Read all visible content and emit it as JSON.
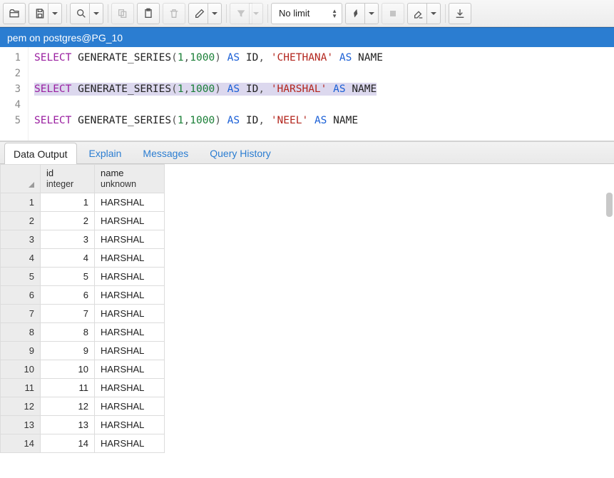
{
  "toolbar": {
    "limit_label": "No limit"
  },
  "titlebar": {
    "text": "pem on postgres@PG_10"
  },
  "editor": {
    "lines": [
      {
        "num": "1",
        "tokens": [
          {
            "t": "SELECT",
            "c": "kw"
          },
          {
            "t": " "
          },
          {
            "t": "GENERATE_SERIES",
            "c": ""
          },
          {
            "t": "(",
            "c": "punc"
          },
          {
            "t": "1",
            "c": "num"
          },
          {
            "t": ",",
            "c": "punc"
          },
          {
            "t": "1000",
            "c": "num"
          },
          {
            "t": ")",
            "c": "punc"
          },
          {
            "t": " "
          },
          {
            "t": "AS",
            "c": "kw2"
          },
          {
            "t": " ID"
          },
          {
            "t": ",",
            "c": "punc"
          },
          {
            "t": " "
          },
          {
            "t": "'CHETHANA'",
            "c": "str"
          },
          {
            "t": " "
          },
          {
            "t": "AS",
            "c": "kw2"
          },
          {
            "t": " NAME"
          }
        ],
        "hl": false
      },
      {
        "num": "2",
        "tokens": [],
        "hl": false
      },
      {
        "num": "3",
        "tokens": [
          {
            "t": "SELECT",
            "c": "kw"
          },
          {
            "t": " "
          },
          {
            "t": "GENERATE_SERIES",
            "c": ""
          },
          {
            "t": "(",
            "c": "punc"
          },
          {
            "t": "1",
            "c": "num"
          },
          {
            "t": ",",
            "c": "punc"
          },
          {
            "t": "1000",
            "c": "num"
          },
          {
            "t": ")",
            "c": "punc"
          },
          {
            "t": " "
          },
          {
            "t": "AS",
            "c": "kw2"
          },
          {
            "t": " ID"
          },
          {
            "t": ",",
            "c": "punc"
          },
          {
            "t": " "
          },
          {
            "t": "'HARSHAL'",
            "c": "str"
          },
          {
            "t": " "
          },
          {
            "t": "AS",
            "c": "kw2"
          },
          {
            "t": " NAME"
          }
        ],
        "hl": true
      },
      {
        "num": "4",
        "tokens": [],
        "hl": false
      },
      {
        "num": "5",
        "tokens": [
          {
            "t": "SELECT",
            "c": "kw"
          },
          {
            "t": " "
          },
          {
            "t": "GENERATE_SERIES",
            "c": ""
          },
          {
            "t": "(",
            "c": "punc"
          },
          {
            "t": "1",
            "c": "num"
          },
          {
            "t": ",",
            "c": "punc"
          },
          {
            "t": "1000",
            "c": "num"
          },
          {
            "t": ")",
            "c": "punc"
          },
          {
            "t": " "
          },
          {
            "t": "AS",
            "c": "kw2"
          },
          {
            "t": " ID"
          },
          {
            "t": ",",
            "c": "punc"
          },
          {
            "t": " "
          },
          {
            "t": "'NEEL'",
            "c": "str"
          },
          {
            "t": " "
          },
          {
            "t": "AS",
            "c": "kw2"
          },
          {
            "t": " NAME"
          }
        ],
        "hl": false
      }
    ]
  },
  "tabs": {
    "data_output": "Data Output",
    "explain": "Explain",
    "messages": "Messages",
    "query_history": "Query History"
  },
  "grid": {
    "columns": [
      {
        "name": "id",
        "type": "integer"
      },
      {
        "name": "name",
        "type": "unknown"
      }
    ],
    "rows": [
      {
        "n": "1",
        "id": "1",
        "name": "HARSHAL"
      },
      {
        "n": "2",
        "id": "2",
        "name": "HARSHAL"
      },
      {
        "n": "3",
        "id": "3",
        "name": "HARSHAL"
      },
      {
        "n": "4",
        "id": "4",
        "name": "HARSHAL"
      },
      {
        "n": "5",
        "id": "5",
        "name": "HARSHAL"
      },
      {
        "n": "6",
        "id": "6",
        "name": "HARSHAL"
      },
      {
        "n": "7",
        "id": "7",
        "name": "HARSHAL"
      },
      {
        "n": "8",
        "id": "8",
        "name": "HARSHAL"
      },
      {
        "n": "9",
        "id": "9",
        "name": "HARSHAL"
      },
      {
        "n": "10",
        "id": "10",
        "name": "HARSHAL"
      },
      {
        "n": "11",
        "id": "11",
        "name": "HARSHAL"
      },
      {
        "n": "12",
        "id": "12",
        "name": "HARSHAL"
      },
      {
        "n": "13",
        "id": "13",
        "name": "HARSHAL"
      },
      {
        "n": "14",
        "id": "14",
        "name": "HARSHAL"
      }
    ]
  }
}
